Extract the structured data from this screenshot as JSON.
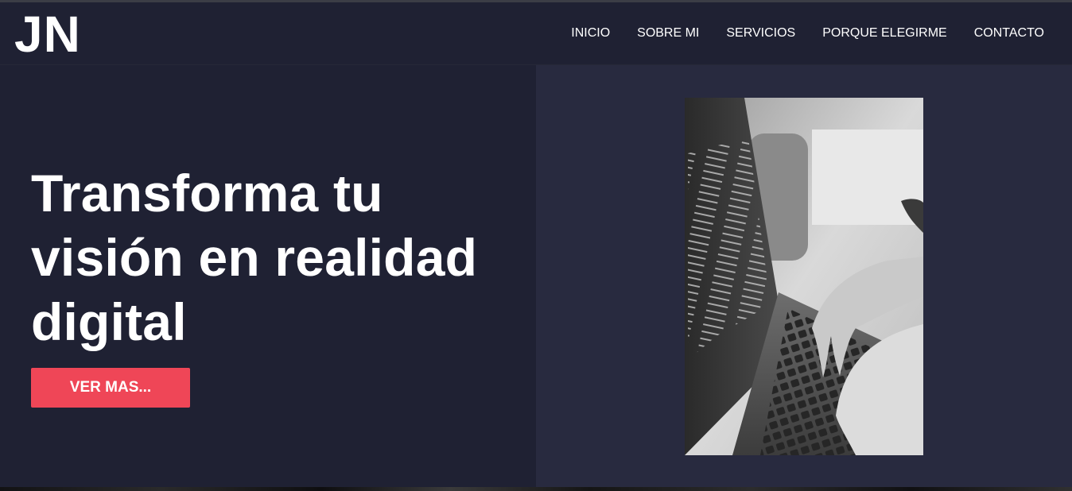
{
  "header": {
    "logo_text": "JN",
    "nav": [
      {
        "label": "INICIO"
      },
      {
        "label": "SOBRE MI"
      },
      {
        "label": "SERVICIOS"
      },
      {
        "label": "PORQUE ELEGIRME"
      },
      {
        "label": "CONTACTO"
      }
    ]
  },
  "hero": {
    "headline": "Transforma tu visión en realidad digital",
    "cta_label": "VER MAS...",
    "image_icon": "laptop-typing-photo"
  },
  "colors": {
    "background": "#1f2133",
    "panel": "#282a3f",
    "accent": "#ef4657",
    "text": "#ffffff"
  }
}
